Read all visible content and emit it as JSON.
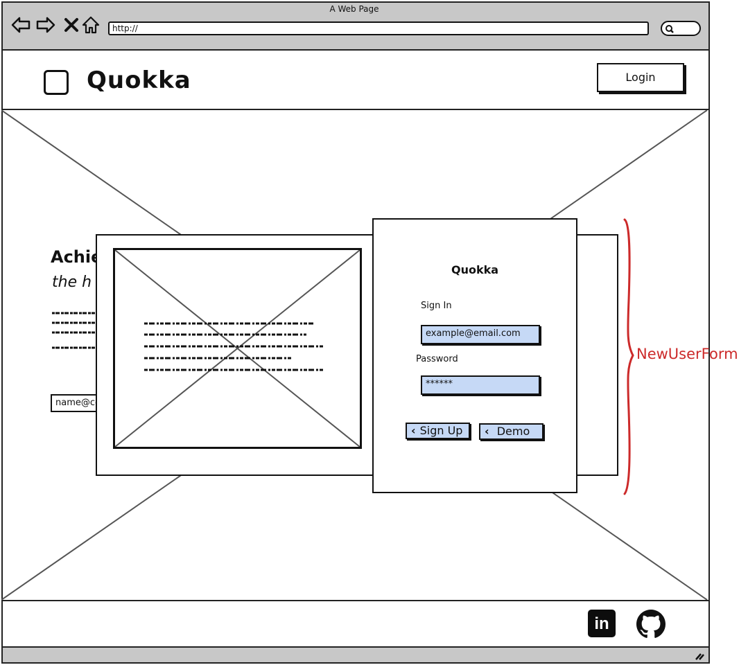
{
  "browser": {
    "window_title": "A Web Page",
    "url": "http://"
  },
  "header": {
    "brand": "Quokka",
    "login_label": "Login"
  },
  "hero": {
    "title": "Achie",
    "subtitle": "the h",
    "email_value": "name@co"
  },
  "modal": {
    "form": {
      "title": "Quokka",
      "sign_in_label": "Sign In",
      "email_value": "example@email.com",
      "password_label": "Password",
      "password_value": "******",
      "signup_label": "Sign Up",
      "demo_label": "Demo"
    }
  },
  "annotation": {
    "label": "NewUserForm",
    "color": "#cc2a2a"
  },
  "footer": {
    "icons": [
      "linkedin-icon",
      "github-icon"
    ]
  },
  "colors": {
    "chrome": "#c8c8c8",
    "field_fill": "#c6d9f6"
  }
}
